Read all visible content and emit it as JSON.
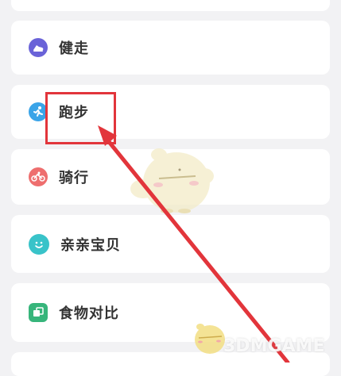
{
  "menu": {
    "items": [
      {
        "label": "健走",
        "icon": "walking-shoe-icon",
        "color": "#6a63d8"
      },
      {
        "label": "跑步",
        "icon": "running-person-icon",
        "color": "#3aa4e8"
      },
      {
        "label": "骑行",
        "icon": "bicycle-icon",
        "color": "#ee6e6e"
      },
      {
        "label": "亲亲宝贝",
        "icon": "baby-face-icon",
        "color": "#39c3c9"
      },
      {
        "label": "食物对比",
        "icon": "food-compare-icon",
        "color": "#37b57b"
      }
    ]
  },
  "annotation": {
    "highlight_color": "#e2353b",
    "target": "跑步"
  },
  "watermark": {
    "text": "3DMGAME"
  }
}
